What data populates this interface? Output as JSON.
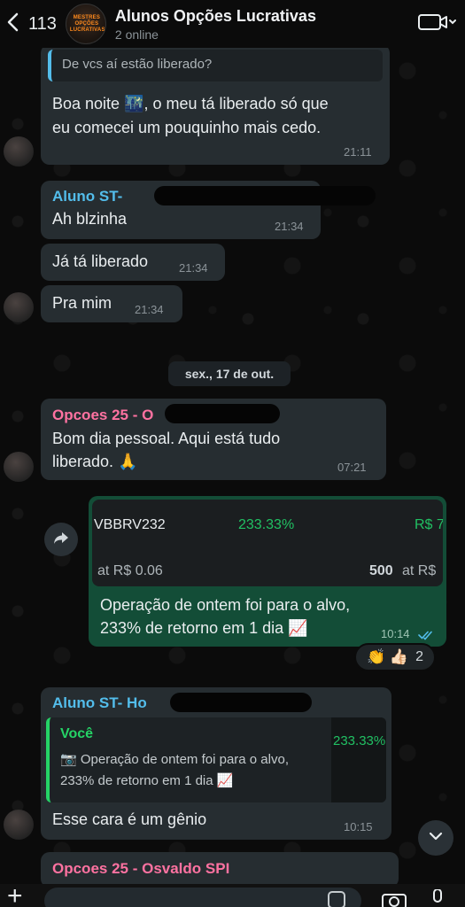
{
  "header": {
    "back_count": "113",
    "title": "Alunos Opções Lucrativas",
    "subtitle": "2 online",
    "avatar_logo": "MESTRES OPÇÕES LUCRATIVAS"
  },
  "messages": [
    {
      "quote": "De vcs aí estão liberado?",
      "text_line1": "Boa noite 🌃, o meu tá liberado só que",
      "text_line2": "eu comecei um pouquinho mais cedo.",
      "time": "21:11"
    },
    {
      "sender": "Aluno ST- ",
      "text": "Ah blzinha",
      "time": "21:34"
    },
    {
      "text": "Já tá liberado",
      "time": "21:34"
    },
    {
      "text": "Pra mim",
      "time": "21:34"
    },
    {
      "sender": "Opcoes 25 - O",
      "text_line1": "Bom dia pessoal. Aqui está tudo",
      "text_line2": "liberado. 🙏",
      "time": "07:21"
    },
    {
      "card": {
        "ticker": "VBBRV232",
        "percent": "233.33%",
        "price": "R$ 7",
        "at_left": "at R$ 0.06",
        "qty": "500",
        "at_right": "at R$"
      },
      "text_line1": "Operação de ontem foi para o alvo,",
      "text_line2": "233% de retorno em 1 dia 📈",
      "time": "10:14"
    },
    {
      "sender": "Aluno ST- Ho",
      "reply": {
        "author": "Você",
        "line1": "📷 Operação de ontem foi para o alvo,",
        "line2": "233% de retorno em 1 dia 📈",
        "thumb_percent": "233.33%"
      },
      "text": "Esse cara é um gênio",
      "time": "10:15"
    },
    {
      "sender": "Opcoes 25 - Osvaldo SPI"
    }
  ],
  "date_separator": "sex., 17 de out.",
  "reactions": {
    "emojis": "👏 👍🏻",
    "count": "2"
  },
  "colors": {
    "sender_blue": "#53bdeb",
    "sender_pink": "#ff72a1",
    "sender_green": "#25d366",
    "outgoing_bubble": "#134d37",
    "percent_green": "#21c063"
  }
}
